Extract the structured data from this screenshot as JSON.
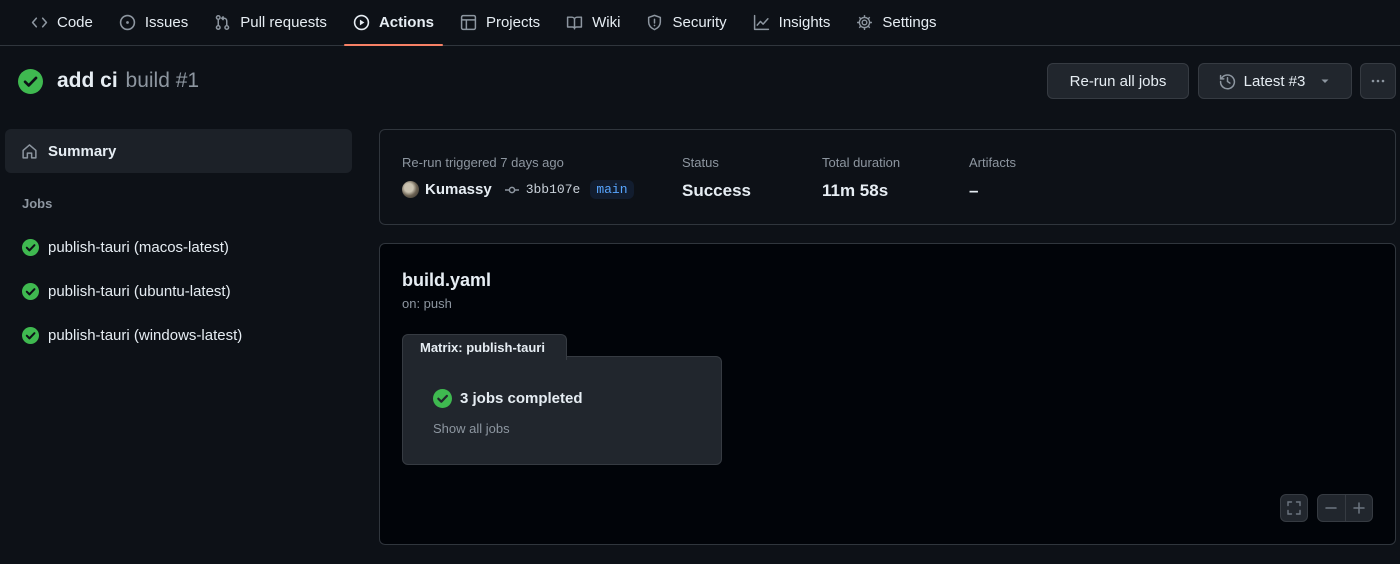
{
  "nav": {
    "items": [
      {
        "label": "Code",
        "icon": "code-icon"
      },
      {
        "label": "Issues",
        "icon": "issue-opened-icon"
      },
      {
        "label": "Pull requests",
        "icon": "git-pull-request-icon"
      },
      {
        "label": "Actions",
        "icon": "play-icon",
        "active": true
      },
      {
        "label": "Projects",
        "icon": "table-icon"
      },
      {
        "label": "Wiki",
        "icon": "book-icon"
      },
      {
        "label": "Security",
        "icon": "shield-icon"
      },
      {
        "label": "Insights",
        "icon": "graph-icon"
      },
      {
        "label": "Settings",
        "icon": "gear-icon"
      }
    ]
  },
  "run": {
    "title": "add ci",
    "workflow_run": "build #1",
    "status": "success",
    "rerun_label": "Re-run all jobs",
    "attempt_label": "Latest #3"
  },
  "sidebar": {
    "summary_label": "Summary",
    "jobs_heading": "Jobs",
    "jobs": [
      {
        "name": "publish-tauri (macos-latest)",
        "status": "success"
      },
      {
        "name": "publish-tauri (ubuntu-latest)",
        "status": "success"
      },
      {
        "name": "publish-tauri (windows-latest)",
        "status": "success"
      }
    ]
  },
  "summary": {
    "trigger_text": "Re-run triggered 7 days ago",
    "actor": "Kumassy",
    "commit_sha": "3bb107e",
    "branch": "main",
    "status_label": "Status",
    "status_value": "Success",
    "duration_label": "Total duration",
    "duration_value": "11m 58s",
    "artifacts_label": "Artifacts",
    "artifacts_value": "–"
  },
  "graph": {
    "workflow_file": "build.yaml",
    "trigger": "on: push",
    "matrix_title": "Matrix: publish-tauri",
    "matrix_status": "3 jobs completed",
    "show_all_label": "Show all jobs"
  },
  "colors": {
    "background": "#0d1117",
    "success": "#3fb950",
    "accent_underline": "#f78166",
    "link": "#58a6ff",
    "muted": "#8d96a0"
  }
}
